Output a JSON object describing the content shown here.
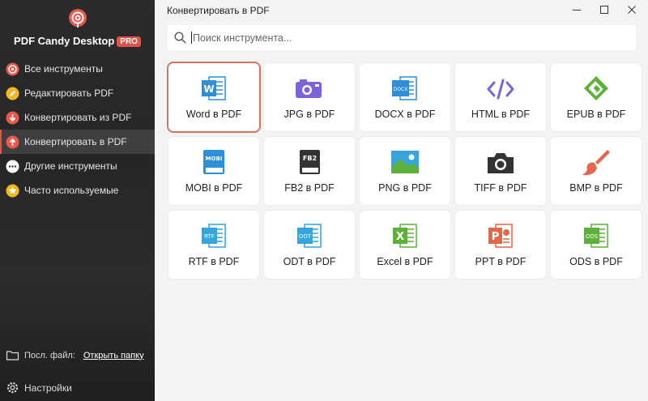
{
  "sidebar": {
    "brand": "PDF Candy Desktop",
    "badge": "PRO",
    "items": [
      {
        "label": "Все инструменты",
        "icon": "all-tools-icon"
      },
      {
        "label": "Редактировать PDF",
        "icon": "edit-pdf-icon"
      },
      {
        "label": "Конвертировать из PDF",
        "icon": "convert-from-pdf-icon"
      },
      {
        "label": "Конвертировать в PDF",
        "icon": "convert-to-pdf-icon",
        "active": true
      },
      {
        "label": "Другие инструменты",
        "icon": "more-tools-icon"
      },
      {
        "label": "Часто используемые",
        "icon": "star-icon"
      }
    ],
    "footer": {
      "last_file_label": "Посл. файл:",
      "open_folder": "Открыть папку",
      "settings": "Настройки"
    }
  },
  "header": {
    "title": "Конвертировать в PDF"
  },
  "search": {
    "placeholder": "Поиск инструмента..."
  },
  "tools": [
    {
      "label": "Word в PDF",
      "icon": "word-icon",
      "selected": true
    },
    {
      "label": "JPG в PDF",
      "icon": "jpg-icon"
    },
    {
      "label": "DOCX в PDF",
      "icon": "docx-icon",
      "tag": "DOCX"
    },
    {
      "label": "HTML в PDF",
      "icon": "html-icon"
    },
    {
      "label": "EPUB в PDF",
      "icon": "epub-icon"
    },
    {
      "label": "MOBI в PDF",
      "icon": "mobi-icon",
      "tag": "MOBI"
    },
    {
      "label": "FB2 в PDF",
      "icon": "fb2-icon",
      "tag": "FB2"
    },
    {
      "label": "PNG в PDF",
      "icon": "png-icon"
    },
    {
      "label": "TIFF в PDF",
      "icon": "camera-icon"
    },
    {
      "label": "BMP в PDF",
      "icon": "brush-icon"
    },
    {
      "label": "RTF в PDF",
      "icon": "rtf-icon",
      "tag": "RTF"
    },
    {
      "label": "ODT в PDF",
      "icon": "odt-icon",
      "tag": "ODT"
    },
    {
      "label": "Excel в PDF",
      "icon": "excel-icon",
      "tag": "X"
    },
    {
      "label": "PPT в PDF",
      "icon": "ppt-icon",
      "tag": "P"
    },
    {
      "label": "ODS в PDF",
      "icon": "ods-icon",
      "tag": "ODS"
    }
  ],
  "colors": {
    "accent": "#e0534a",
    "selected_border": "#d9735f",
    "blue": "#2d8fd8",
    "green": "#5db13b",
    "orange": "#e2674b",
    "purple": "#7b64d8"
  }
}
